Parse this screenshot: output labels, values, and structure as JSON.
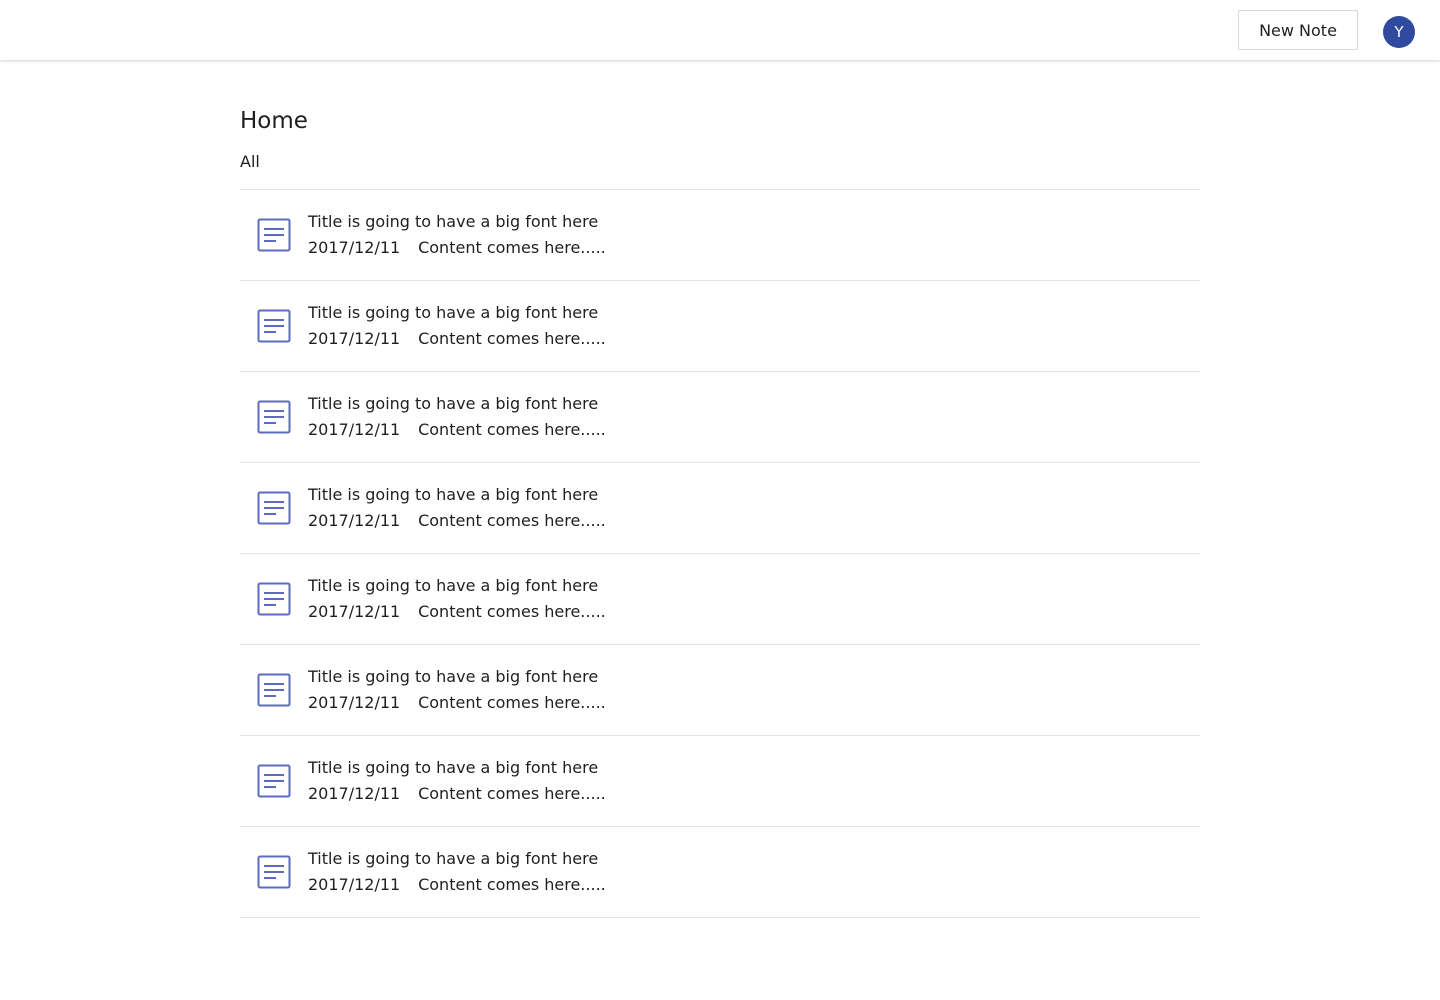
{
  "header": {
    "new_note_label": "New Note",
    "avatar_initial": "Y",
    "avatar_color": "#2f4a9e"
  },
  "main": {
    "title": "Home",
    "filter_label": "All"
  },
  "colors": {
    "icon": "#5b6bbf",
    "divider": "#e3e3e3"
  },
  "notes": [
    {
      "icon": "document-icon",
      "title": "Title is going to have a big font here",
      "date": "2017/12/11",
      "snippet": "Content comes here....."
    },
    {
      "icon": "document-icon",
      "title": "Title is going to have a big font here",
      "date": "2017/12/11",
      "snippet": "Content comes here....."
    },
    {
      "icon": "document-icon",
      "title": "Title is going to have a big font here",
      "date": "2017/12/11",
      "snippet": "Content comes here....."
    },
    {
      "icon": "document-icon",
      "title": "Title is going to have a big font here",
      "date": "2017/12/11",
      "snippet": "Content comes here....."
    },
    {
      "icon": "document-icon",
      "title": "Title is going to have a big font here",
      "date": "2017/12/11",
      "snippet": "Content comes here....."
    },
    {
      "icon": "document-icon",
      "title": "Title is going to have a big font here",
      "date": "2017/12/11",
      "snippet": "Content comes here....."
    },
    {
      "icon": "document-icon",
      "title": "Title is going to have a big font here",
      "date": "2017/12/11",
      "snippet": "Content comes here....."
    },
    {
      "icon": "document-icon",
      "title": "Title is going to have a big font here",
      "date": "2017/12/11",
      "snippet": "Content comes here....."
    }
  ]
}
